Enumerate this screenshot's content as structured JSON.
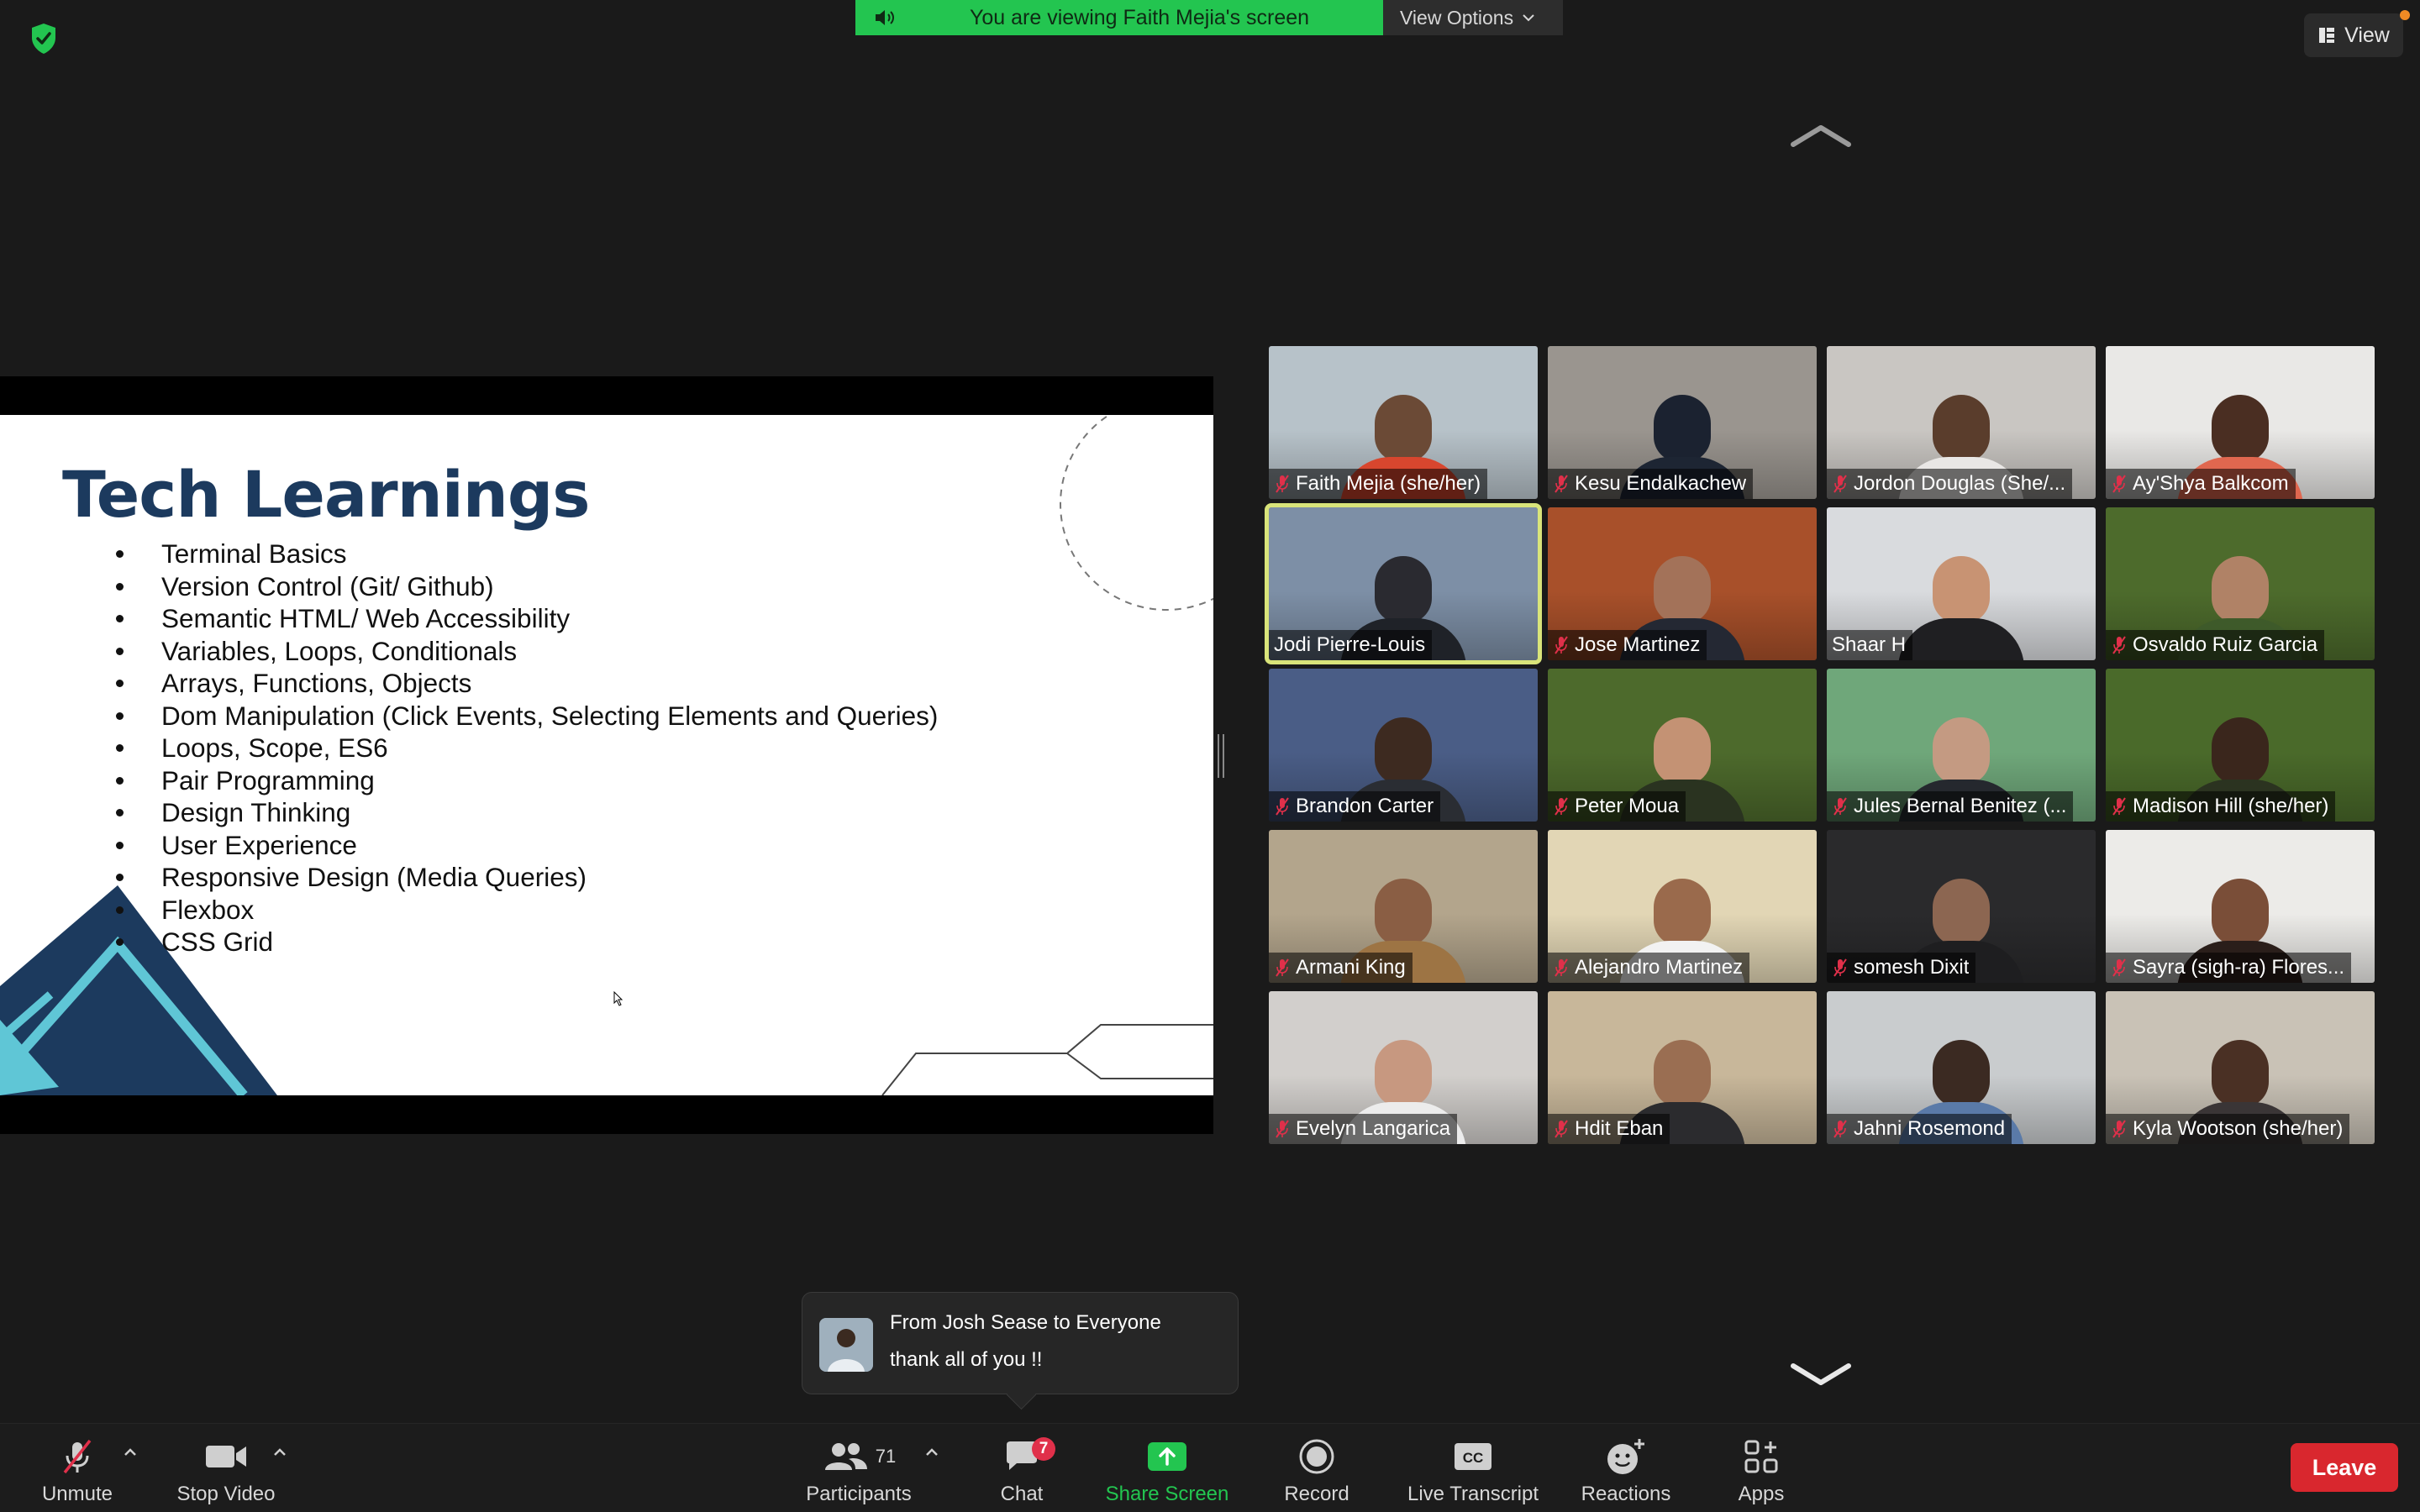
{
  "banner": {
    "sharing_text": "You are viewing Faith Mejia's screen",
    "view_options_label": "View Options"
  },
  "view_button_label": "View",
  "slide": {
    "title": "Tech Learnings",
    "bullets": [
      "Terminal Basics",
      "Version Control (Git/ Github)",
      "Semantic HTML/ Web Accessibility",
      "Variables, Loops, Conditionals",
      "Arrays, Functions, Objects",
      "Dom Manipulation (Click Events, Selecting Elements and Queries)",
      "Loops, Scope, ES6",
      "Pair Programming",
      "Design Thinking",
      "User Experience",
      "Responsive Design (Media Queries)",
      "Flexbox",
      "CSS Grid"
    ]
  },
  "participants": [
    {
      "name": "Faith Mejia  (she/her)",
      "muted": true,
      "bg": "#b7c2c9",
      "skin": "#6b4a36",
      "shirt": "#d8462e"
    },
    {
      "name": "Kesu Endalkachew",
      "muted": true,
      "bg": "#9a958f",
      "skin": "#1b2230",
      "shirt": "#1d2533"
    },
    {
      "name": "Jordon Douglas (She/...",
      "muted": true,
      "bg": "#c9c6c2",
      "skin": "#5a3d2c",
      "shirt": "#e9e7e5"
    },
    {
      "name": "Ay'Shya Balkcom",
      "muted": true,
      "bg": "#e9e8e6",
      "skin": "#4a2e22",
      "shirt": "#e0674f"
    },
    {
      "name": "Jodi Pierre-Louis",
      "muted": false,
      "active": true,
      "bg": "#7d8fa6",
      "skin": "#2a2a30",
      "shirt": "#1f2228"
    },
    {
      "name": "Jose Martinez",
      "muted": true,
      "bg": "#a8502a",
      "skin": "#a37259",
      "shirt": "#242833"
    },
    {
      "name": "Shaar H",
      "muted": false,
      "bg": "#d9dbde",
      "skin": "#c89373",
      "shirt": "#1f1f22"
    },
    {
      "name": "Osvaldo Ruiz Garcia",
      "muted": true,
      "bg": "#4d6b2c",
      "skin": "#b08266",
      "shirt": "#3e5a2a"
    },
    {
      "name": "Brandon Carter",
      "muted": true,
      "bg": "#4a5d86",
      "skin": "#3d2a20",
      "shirt": "#2a2d33"
    },
    {
      "name": "Peter Moua",
      "muted": true,
      "bg": "#4d6a2c",
      "skin": "#c49274",
      "shirt": "#2a3320"
    },
    {
      "name": "Jules Bernal Benitez (...",
      "muted": true,
      "bg": "#6fa77a",
      "skin": "#c49a82",
      "shirt": "#25282e"
    },
    {
      "name": "Madison Hill (she/her)",
      "muted": true,
      "bg": "#4a6a2a",
      "skin": "#3a261c",
      "shirt": "#2b3320"
    },
    {
      "name": "Armani King",
      "muted": true,
      "bg": "#b3a58c",
      "skin": "#8a5e44",
      "shirt": "#9d7444"
    },
    {
      "name": "Alejandro Martinez",
      "muted": true,
      "bg": "#e2d6b5",
      "skin": "#9a6a4c",
      "shirt": "#f2f2f2"
    },
    {
      "name": "somesh Dixit",
      "muted": true,
      "bg": "#2a2a2c",
      "skin": "#8c6651",
      "shirt": "#1e1e20"
    },
    {
      "name": "Sayra (sigh-ra) Flores...",
      "muted": true,
      "bg": "#ecebe8",
      "skin": "#7a4e38",
      "shirt": "#2a1e1a"
    },
    {
      "name": "Evelyn Langarica",
      "muted": true,
      "bg": "#d2cfcc",
      "skin": "#c79880",
      "shirt": "#ececec"
    },
    {
      "name": "Hdit Eban",
      "muted": true,
      "bg": "#c8b79a",
      "skin": "#9a6e52",
      "shirt": "#2b2b2e"
    },
    {
      "name": "Jahni Rosemond",
      "muted": true,
      "bg": "#c9ccce",
      "skin": "#3b2a22",
      "shirt": "#5a7aa8"
    },
    {
      "name": "Kyla Wootson  (she/her)",
      "muted": true,
      "bg": "#c9c2b6",
      "skin": "#4a3024",
      "shirt": "#3a3536"
    }
  ],
  "chat_toast": {
    "from": "From Josh Sease to Everyone",
    "message": "thank all of you !!"
  },
  "toolbar": {
    "unmute_label": "Unmute",
    "stop_video_label": "Stop Video",
    "participants_label": "Participants",
    "participants_count": "71",
    "chat_label": "Chat",
    "chat_badge": "7",
    "share_screen_label": "Share Screen",
    "record_label": "Record",
    "live_transcript_label": "Live Transcript",
    "reactions_label": "Reactions",
    "apps_label": "Apps",
    "leave_label": "Leave"
  },
  "colors": {
    "background": "#1a1a1a",
    "banner_green": "#23c550",
    "leave_red": "#d9272e",
    "active_speaker": "#d9e47a",
    "muted_red": "#e0304a",
    "slide_title_navy": "#1c3a5e"
  }
}
